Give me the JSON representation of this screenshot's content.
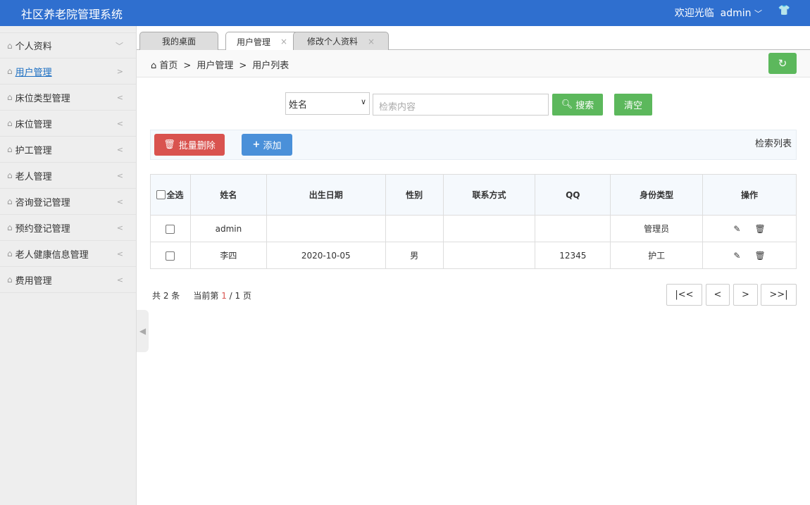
{
  "header": {
    "title": "社区养老院管理系统",
    "welcome": "欢迎光临",
    "user": "admin",
    "user_chevron": "﹀"
  },
  "sidebar": {
    "items": [
      {
        "label": "个人资料",
        "arrow": "﹀"
      },
      {
        "label": "用户管理",
        "arrow": ">"
      },
      {
        "label": "床位类型管理",
        "arrow": "<"
      },
      {
        "label": "床位管理",
        "arrow": "<"
      },
      {
        "label": "护工管理",
        "arrow": "<"
      },
      {
        "label": "老人管理",
        "arrow": "<"
      },
      {
        "label": "咨询登记管理",
        "arrow": "<"
      },
      {
        "label": "预约登记管理",
        "arrow": "<"
      },
      {
        "label": "老人健康信息管理",
        "arrow": "<"
      },
      {
        "label": "费用管理",
        "arrow": "<"
      }
    ]
  },
  "tabs": [
    {
      "label": "我的桌面"
    },
    {
      "label": "用户管理",
      "close": "×"
    },
    {
      "label": "修改个人资料",
      "close": "×"
    }
  ],
  "breadcrumb": [
    "首页",
    "用户管理",
    "用户列表"
  ],
  "search": {
    "field": "姓名",
    "placeholder": "检索内容",
    "search_label": "搜索",
    "clear_label": "清空"
  },
  "toolbar": {
    "batch_delete": "批量删除",
    "add": "添加",
    "right_label": "检索列表"
  },
  "table": {
    "headers": [
      "全选",
      "姓名",
      "出生日期",
      "性别",
      "联系方式",
      "QQ",
      "身份类型",
      "操作"
    ],
    "rows": [
      [
        "admin",
        "",
        "",
        "",
        "",
        "管理员"
      ],
      [
        "李四",
        "2020-10-05",
        "男",
        "",
        "12345",
        "护工"
      ]
    ]
  },
  "pagination": {
    "total": "共 2 条",
    "current_prefix": "当前第",
    "current": "1",
    "total_pages": "/ 1 页",
    "first": "|<<",
    "prev": "<",
    "next": ">",
    "last": ">>|"
  },
  "colors": {
    "header": "#2f6fcf",
    "green": "#5cb85c",
    "red": "#d9534f",
    "blue": "#4a90d9"
  }
}
